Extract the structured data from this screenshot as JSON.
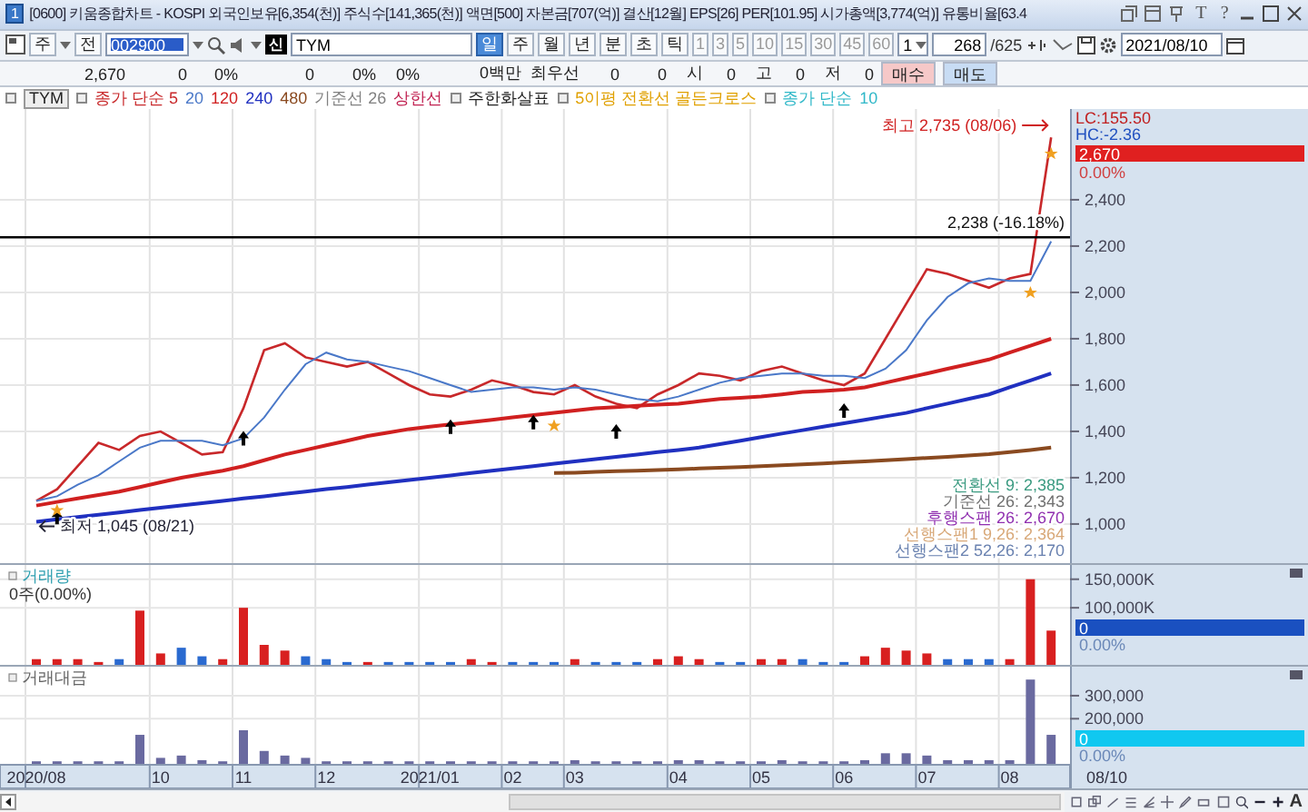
{
  "window": {
    "title": "[0600] 키움종합차트 - KOSPI 외국인보유[6,354(천)] 주식수[141,365(천)] 액면[500] 자본금[707(억)] 결산[12월] EPS[26] PER[101.95] 시가총액[3,774(억)] 유통비율[63.4",
    "app_badge": "1",
    "title_buttons": [
      "T",
      "?"
    ]
  },
  "toolbar": {
    "market": "주",
    "prev": "전",
    "code": "002900",
    "new_badge": "신",
    "name": "TYM",
    "periods": [
      {
        "label": "일",
        "selected": true
      },
      {
        "label": "주",
        "selected": false
      },
      {
        "label": "월",
        "selected": false
      },
      {
        "label": "년",
        "selected": false
      },
      {
        "label": "분",
        "selected": false
      },
      {
        "label": "초",
        "selected": false
      },
      {
        "label": "틱",
        "selected": false
      }
    ],
    "intervals": [
      "1",
      "3",
      "5",
      "10",
      "15",
      "30",
      "45",
      "60"
    ],
    "multiplier": "1",
    "count": "268",
    "total": "/625",
    "date": "2021/08/10"
  },
  "quote": {
    "items": [
      "2,670",
      "0",
      "0%",
      "0",
      "0%",
      "0%",
      "0백만",
      "최우선",
      "0",
      "0",
      "시",
      "0",
      "고",
      "0",
      "저",
      "0"
    ],
    "buy": "매수",
    "sell": "매도"
  },
  "legend": {
    "symbol": "TYM",
    "middle": [
      {
        "text": "기준선 26",
        "color": "#808080"
      },
      {
        "text": "상한선",
        "color": "#c02050"
      }
    ],
    "signals": [
      {
        "text": "주한화살표",
        "color": "#202020"
      },
      {
        "text": "5이평 전환선 골든크로스",
        "color": "#e0a000"
      }
    ],
    "tail": [
      {
        "text": "종가 단순",
        "color": "#30b8c8"
      },
      {
        "text": "10",
        "color": "#30b8c8"
      }
    ]
  },
  "price_panel": {
    "reference_label": "2,238 (-16.18%)",
    "lc": "LC:155.50",
    "hc": "HC:-2.36",
    "current": "2,670",
    "change": "0.00%",
    "indicators": [
      {
        "text": "전환선 9: 2,385",
        "color": "#3a9a80"
      },
      {
        "text": "기준선 26: 2,343",
        "color": "#707070"
      },
      {
        "text": "후행스팬 26: 2,670",
        "color": "#9030b0"
      },
      {
        "text": "선행스팬1 9,26: 2,364",
        "color": "#d8a878"
      },
      {
        "text": "선행스팬2 52,26: 2,170",
        "color": "#6a82b0"
      }
    ],
    "chart_data": {
      "type": "line",
      "grid": true,
      "ylim": [
        831,
        2792
      ],
      "yticks": [
        {
          "value": 1000,
          "label": "1,000"
        },
        {
          "value": 1200,
          "label": "1,200"
        },
        {
          "value": 1400,
          "label": "1,400"
        },
        {
          "value": 1600,
          "label": "1,600"
        },
        {
          "value": 1800,
          "label": "1,800"
        },
        {
          "value": 2000,
          "label": "2,000"
        },
        {
          "value": 2200,
          "label": "2,200"
        },
        {
          "value": 2400,
          "label": "2,400"
        }
      ],
      "series": [
        {
          "name": "종가 단순 5",
          "color": "#c8282a",
          "values": [
            1100,
            1150,
            1250,
            1350,
            1320,
            1380,
            1400,
            1350,
            1300,
            1310,
            1500,
            1750,
            1780,
            1720,
            1700,
            1680,
            1700,
            1650,
            1600,
            1560,
            1550,
            1580,
            1620,
            1600,
            1570,
            1560,
            1600,
            1550,
            1520,
            1500,
            1560,
            1600,
            1650,
            1640,
            1620,
            1660,
            1680,
            1650,
            1620,
            1600,
            1650,
            1800,
            1950,
            2100,
            2080,
            2050,
            2020,
            2060,
            2080,
            2670
          ]
        },
        {
          "name": "20",
          "color": "#4a78c8",
          "values": [
            1100,
            1120,
            1170,
            1210,
            1270,
            1330,
            1360,
            1360,
            1360,
            1340,
            1370,
            1460,
            1580,
            1690,
            1740,
            1710,
            1700,
            1680,
            1660,
            1630,
            1600,
            1570,
            1580,
            1590,
            1590,
            1580,
            1590,
            1580,
            1560,
            1540,
            1530,
            1550,
            1580,
            1610,
            1630,
            1640,
            1650,
            1650,
            1640,
            1640,
            1630,
            1670,
            1750,
            1880,
            1980,
            2040,
            2060,
            2050,
            2050,
            2220
          ]
        },
        {
          "name": "120",
          "color": "#d02020",
          "values": [
            1080,
            1095,
            1110,
            1125,
            1140,
            1160,
            1180,
            1200,
            1215,
            1230,
            1250,
            1275,
            1300,
            1320,
            1340,
            1360,
            1380,
            1395,
            1410,
            1420,
            1430,
            1440,
            1450,
            1460,
            1470,
            1480,
            1490,
            1500,
            1505,
            1510,
            1515,
            1520,
            1530,
            1540,
            1545,
            1550,
            1560,
            1570,
            1575,
            1580,
            1590,
            1610,
            1630,
            1650,
            1670,
            1690,
            1710,
            1740,
            1770,
            1800
          ]
        },
        {
          "name": "240",
          "color": "#2030c0",
          "values": [
            1010,
            1020,
            1030,
            1040,
            1050,
            1060,
            1070,
            1080,
            1090,
            1100,
            1110,
            1120,
            1130,
            1140,
            1150,
            1160,
            1170,
            1180,
            1190,
            1200,
            1210,
            1220,
            1230,
            1240,
            1250,
            1260,
            1270,
            1280,
            1290,
            1300,
            1310,
            1320,
            1330,
            1345,
            1360,
            1375,
            1390,
            1405,
            1420,
            1435,
            1450,
            1465,
            1480,
            1500,
            1520,
            1540,
            1560,
            1590,
            1620,
            1650
          ]
        },
        {
          "name": "480",
          "color": "#8a4a20",
          "values": [
            null,
            null,
            null,
            null,
            null,
            null,
            null,
            null,
            null,
            null,
            null,
            null,
            null,
            null,
            null,
            null,
            null,
            null,
            null,
            null,
            null,
            null,
            null,
            null,
            null,
            1220,
            1222,
            1225,
            1228,
            1230,
            1233,
            1236,
            1240,
            1243,
            1246,
            1250,
            1254,
            1258,
            1262,
            1266,
            1270,
            1275,
            1280,
            1285,
            1290,
            1296,
            1302,
            1310,
            1320,
            1330
          ]
        }
      ],
      "annotations": [
        "최고 2,735 (08/06)",
        "최저 1,045 (08/21)"
      ]
    }
  },
  "volume_panel": {
    "title": "거래량",
    "reading": "0주(0.00%)",
    "current": "0",
    "change": "0.00%",
    "chart_data": {
      "type": "bar",
      "grid": true,
      "ylim": [
        0,
        175000
      ],
      "yticks": [
        {
          "value": 100000,
          "label": "100,000K"
        },
        {
          "value": 150000,
          "label": "150,000K"
        }
      ],
      "values": [
        10000,
        10000,
        10000,
        5000,
        10000,
        95000,
        20000,
        30000,
        15000,
        10000,
        100000,
        35000,
        25000,
        15000,
        10000,
        5000,
        5000,
        5000,
        5000,
        5000,
        5000,
        10000,
        5000,
        5000,
        5000,
        5000,
        10000,
        5000,
        5000,
        5000,
        10000,
        15000,
        10000,
        5000,
        5000,
        10000,
        10000,
        10000,
        5000,
        5000,
        15000,
        30000,
        25000,
        20000,
        10000,
        10000,
        10000,
        10000,
        150000,
        60000
      ]
    }
  },
  "amount_panel": {
    "title": "거래대금",
    "current": "0",
    "change": "0.00%",
    "last_date": "08/10",
    "chart_data": {
      "type": "bar",
      "grid": true,
      "ylim": [
        0,
        426000
      ],
      "yticks": [
        {
          "value": 200000,
          "label": "200,000"
        },
        {
          "value": 300000,
          "label": "300,000"
        }
      ],
      "categories": [
        "2020/08",
        null,
        null,
        null,
        null,
        null,
        "10",
        null,
        null,
        null,
        "11",
        null,
        null,
        null,
        "12",
        null,
        null,
        null,
        null,
        "2021/01",
        null,
        null,
        null,
        "02",
        null,
        null,
        "03",
        null,
        null,
        null,
        null,
        "04",
        null,
        null,
        null,
        "05",
        null,
        null,
        null,
        "06",
        null,
        null,
        null,
        "07",
        null,
        null,
        null,
        "08",
        null,
        null
      ],
      "values": [
        15000,
        15000,
        15000,
        15000,
        15000,
        130000,
        30000,
        40000,
        20000,
        15000,
        150000,
        60000,
        40000,
        30000,
        15000,
        15000,
        15000,
        15000,
        15000,
        15000,
        15000,
        15000,
        15000,
        15000,
        15000,
        15000,
        20000,
        15000,
        15000,
        15000,
        15000,
        20000,
        20000,
        15000,
        15000,
        15000,
        20000,
        15000,
        15000,
        15000,
        20000,
        50000,
        50000,
        40000,
        20000,
        20000,
        20000,
        20000,
        370000,
        130000
      ]
    }
  },
  "bottom_bar": {
    "text_button": "A"
  }
}
